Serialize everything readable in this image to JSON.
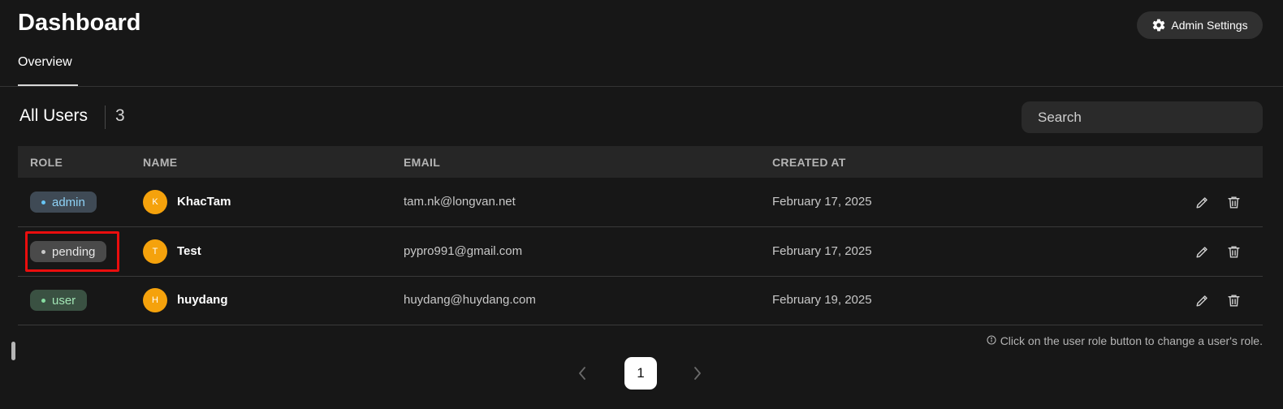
{
  "header": {
    "title": "Dashboard",
    "admin_settings_label": "Admin Settings",
    "tabs": [
      {
        "label": "Overview"
      }
    ]
  },
  "users": {
    "title": "All Users",
    "count": "3",
    "search_placeholder": "Search",
    "columns": [
      "ROLE",
      "NAME",
      "EMAIL",
      "CREATED AT"
    ],
    "rows": [
      {
        "role": "admin",
        "initial": "K",
        "name": "KhacTam",
        "email": "tam.nk@longvan.net",
        "created": "February 17, 2025"
      },
      {
        "role": "pending",
        "initial": "T",
        "name": "Test",
        "email": "pypro991@gmail.com",
        "created": "February 17, 2025"
      },
      {
        "role": "user",
        "initial": "H",
        "name": "huydang",
        "email": "huydang@huydang.com",
        "created": "February 19, 2025"
      }
    ],
    "hint": "Click on the user role button to change a user's role."
  },
  "pagination": {
    "current_page": "1"
  },
  "colors": {
    "background": "#171717",
    "avatar": "#f5a20c",
    "admin_badge": "#3f4a55",
    "pending_badge": "#4a4a4a",
    "user_badge": "#3a5142",
    "highlight": "#ea0e0e"
  }
}
